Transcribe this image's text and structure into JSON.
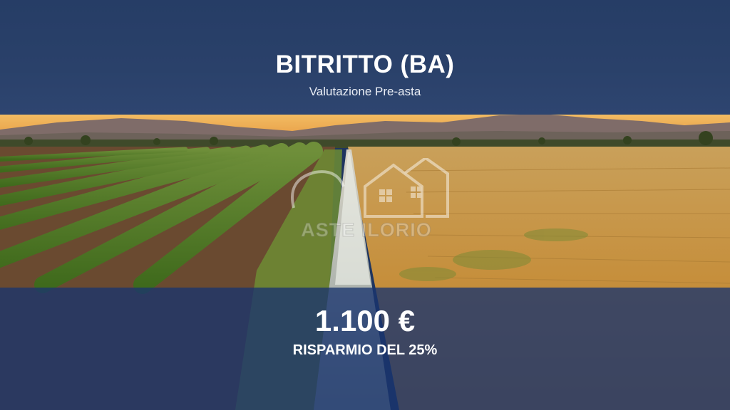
{
  "header": {
    "title": "BITRITTO (BA)",
    "subtitle": "Valutazione Pre-asta"
  },
  "offer": {
    "price": "1.100 €",
    "saving": "RISPARMIO DEL 25%"
  },
  "watermark": {
    "text": "ASTE ILORIO",
    "icon": "house-logo-icon"
  },
  "colors": {
    "header_band": "#2a416a",
    "price_band": "#1a346e",
    "sky": "#f1b45a",
    "crops": "#5f8a2a",
    "dry_field": "#c9953f",
    "text": "#ffffff"
  }
}
